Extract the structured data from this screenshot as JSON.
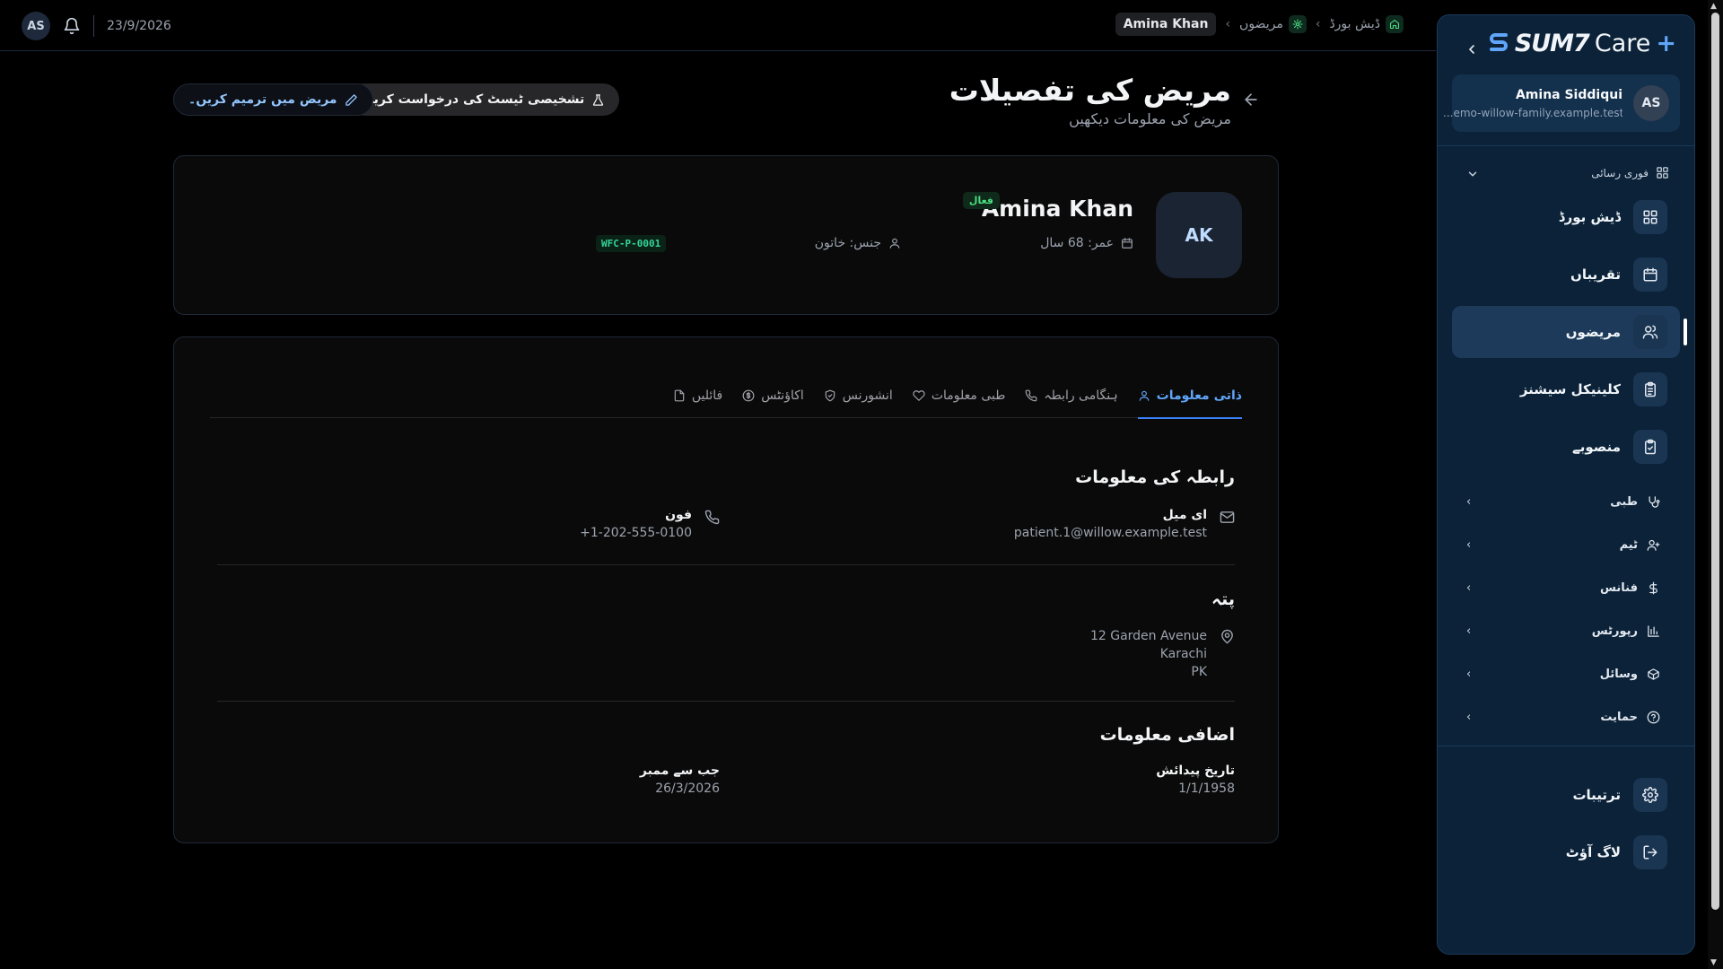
{
  "topbar": {
    "avatar_initials": "AS",
    "date": "23/9/2026",
    "breadcrumb_current": "Amina Khan",
    "breadcrumb_patients": "مریضوں",
    "breadcrumb_dashboard": "ڈیش بورڈ"
  },
  "header": {
    "title": "مریض کی تفصیلات",
    "subtitle": "مریض کی معلومات دیکھیں",
    "request_test_label": "تشخیصی ٹیسٹ کی درخواست کریں",
    "edit_label": "مریض میں ترمیم کریں۔"
  },
  "patient": {
    "initials": "AK",
    "name": "Amina Khan",
    "status": "فعال",
    "age": "عمر: 68 سال",
    "gender": "جنس: خاتون",
    "id": "WFC-P-0001"
  },
  "tabs": [
    {
      "label": "ذاتی معلومات",
      "icon": "user-icon"
    },
    {
      "label": "ہنگامی رابطہ",
      "icon": "phone-icon"
    },
    {
      "label": "طبی معلومات",
      "icon": "heart-icon"
    },
    {
      "label": "انشورنس",
      "icon": "shield-icon"
    },
    {
      "label": "اکاؤنٹس",
      "icon": "dollar-icon"
    },
    {
      "label": "فائلیں",
      "icon": "file-icon"
    }
  ],
  "contact": {
    "title": "رابطہ کی معلومات",
    "email_label": "ای میل",
    "email_value": "patient.1@willow.example.test",
    "phone_label": "فون",
    "phone_value": "+1-202-555-0100"
  },
  "address": {
    "title": "پتہ",
    "line1": "12 Garden Avenue",
    "line2": "Karachi",
    "line3": "PK"
  },
  "additional": {
    "title": "اضافی معلومات",
    "dob_label": "تاریخ پیدائش",
    "dob_value": "1/1/1958",
    "member_label": "جب سے ممبر",
    "member_value": "26/3/2026"
  },
  "sidebar": {
    "brand_main": "SUM7",
    "brand_care": "Care",
    "brand_plus": "+",
    "user_initials": "AS",
    "user_name": "Amina Siddiqui",
    "user_email": "...emo-willow-family.example.test",
    "quick_access": "فوری رسائی",
    "nav": [
      {
        "label": "ڈیش بورڈ",
        "icon": "grid-icon"
      },
      {
        "label": "تقریباں",
        "icon": "calendar-icon"
      },
      {
        "label": "مریضوں",
        "icon": "users-icon"
      },
      {
        "label": "کلینیکل سیشنز",
        "icon": "clipboard-icon"
      },
      {
        "label": "منصوبے",
        "icon": "clipboard-check-icon"
      }
    ],
    "groups": [
      {
        "label": "طبی",
        "icon": "stethoscope-icon"
      },
      {
        "label": "ٹیم",
        "icon": "team-icon"
      },
      {
        "label": "فنانس",
        "icon": "dollar-icon"
      },
      {
        "label": "رپورٹس",
        "icon": "bar-chart-icon"
      },
      {
        "label": "وسائل",
        "icon": "box-icon"
      },
      {
        "label": "حمایت",
        "icon": "help-icon"
      }
    ],
    "settings_label": "ترتیبات",
    "logout_label": "لاگ آؤٹ"
  },
  "colors": {
    "accent": "#3b82f6",
    "sidebar_bg": "#0b2238",
    "status_green": "#4ade80"
  }
}
